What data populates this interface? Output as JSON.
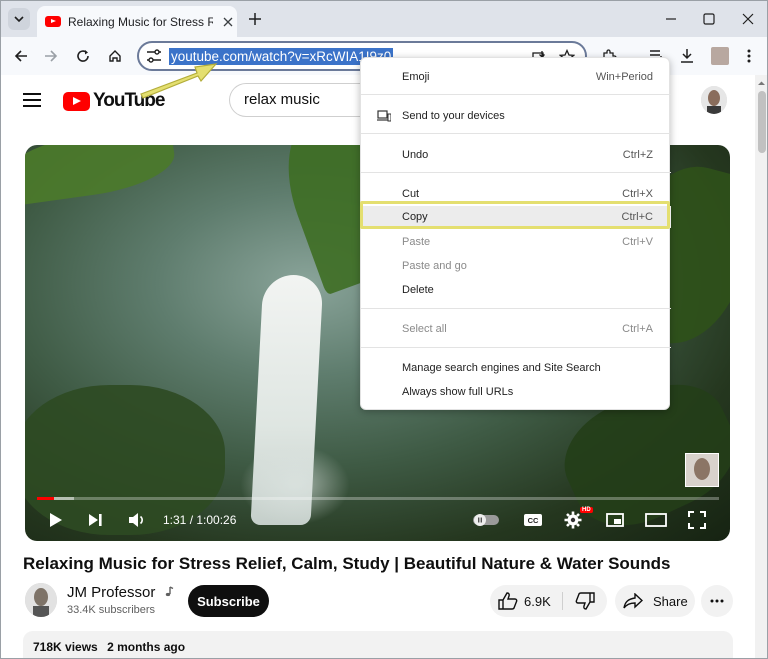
{
  "browser": {
    "tab_title": "Relaxing Music for Stress Relief",
    "url": "youtube.com/watch?v=xRcWIA1I9z0"
  },
  "youtube": {
    "logo_text": "YouTube",
    "search_value": "relax music"
  },
  "player": {
    "time": "1:31 / 1:00:26",
    "hd_badge": "HD",
    "progress_fraction": 0.025,
    "cc_label": "CC"
  },
  "video": {
    "title": "Relaxing Music for Stress Relief, Calm, Study | Beautiful Nature & Water Sounds",
    "channel_name": "JM Professor",
    "subscribers": "33.4K subscribers",
    "subscribe_label": "Subscribe",
    "likes": "6.9K",
    "share_label": "Share",
    "views": "718K views",
    "age": "2 months ago"
  },
  "context_menu": {
    "emoji": {
      "label": "Emoji",
      "shortcut": "Win+Period"
    },
    "send": {
      "label": "Send to your devices"
    },
    "undo": {
      "label": "Undo",
      "shortcut": "Ctrl+Z"
    },
    "cut": {
      "label": "Cut",
      "shortcut": "Ctrl+X"
    },
    "copy": {
      "label": "Copy",
      "shortcut": "Ctrl+C"
    },
    "paste": {
      "label": "Paste",
      "shortcut": "Ctrl+V"
    },
    "paste_go": {
      "label": "Paste and go"
    },
    "delete": {
      "label": "Delete"
    },
    "select_all": {
      "label": "Select all",
      "shortcut": "Ctrl+A"
    },
    "manage": {
      "label": "Manage search engines and Site Search"
    },
    "show_urls": {
      "label": "Always show full URLs"
    }
  },
  "colors": {
    "url_highlight": "#3b73c9",
    "annotation_yellow": "#e4df70",
    "youtube_red": "#ff0000"
  }
}
